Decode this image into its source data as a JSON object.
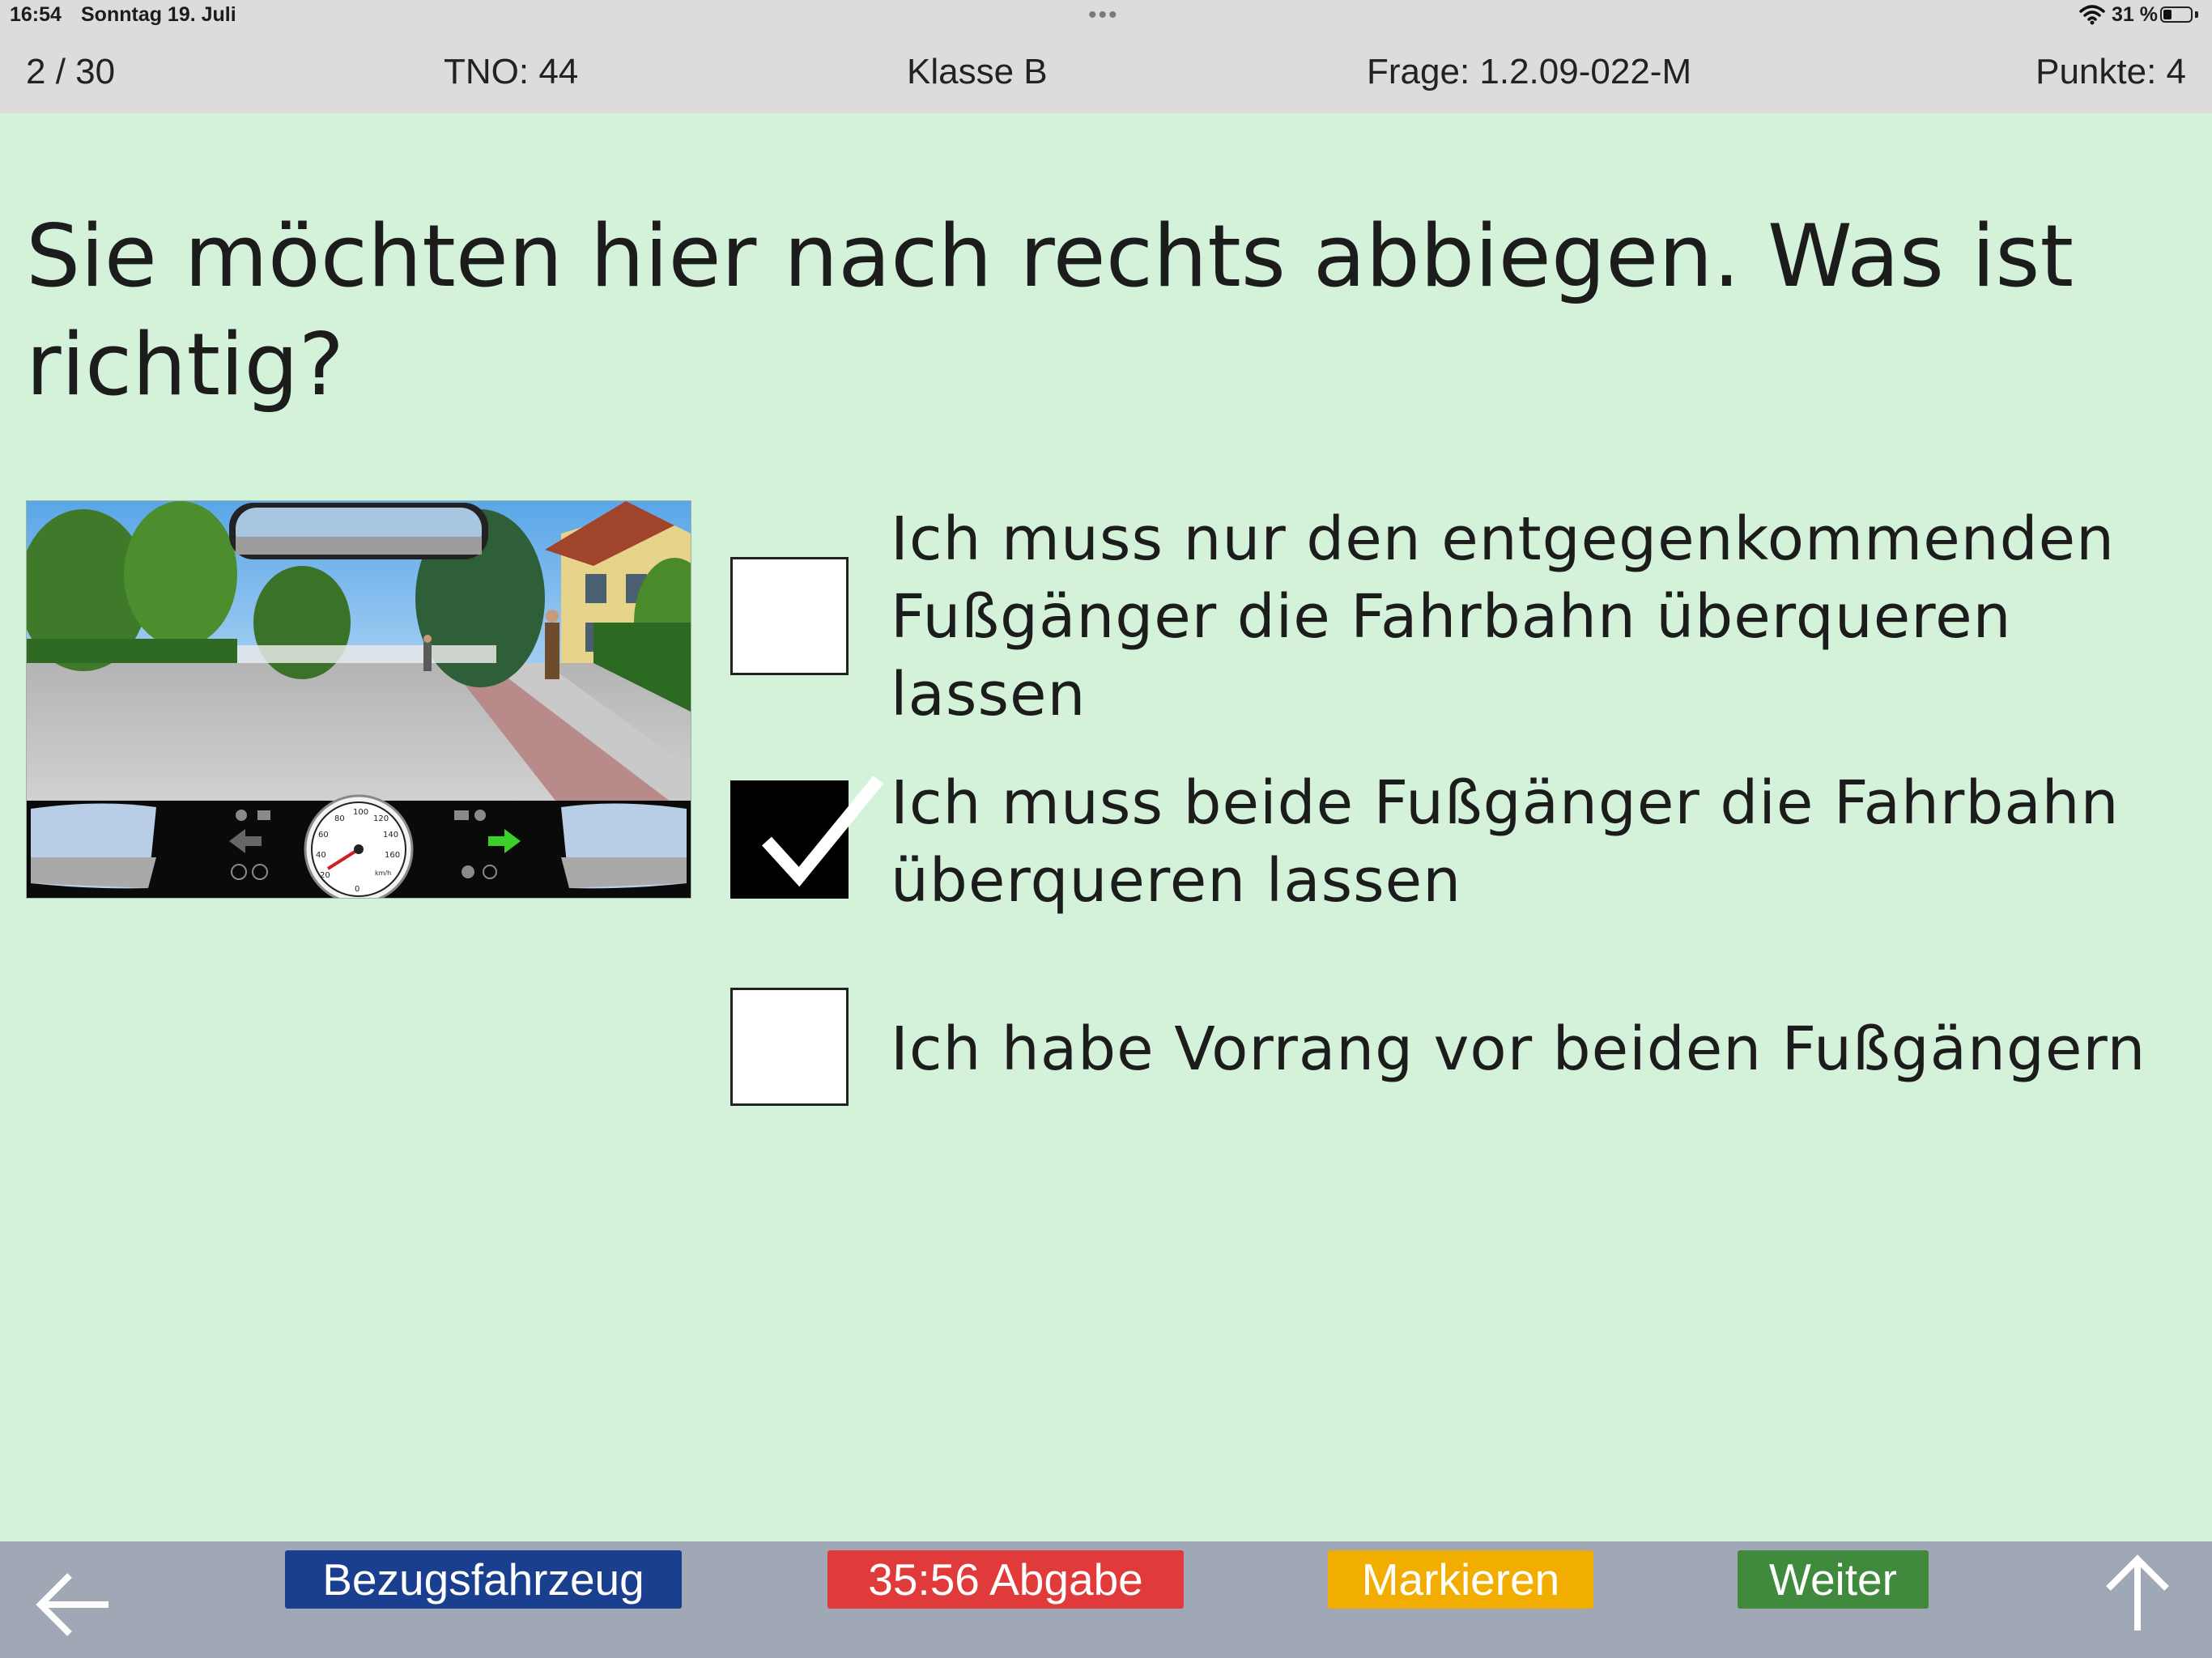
{
  "status_bar": {
    "time": "16:54",
    "date": "Sonntag 19. Juli",
    "battery": "31 %",
    "battery_level": 0.31,
    "icons": [
      "more-dots-icon",
      "wifi-icon",
      "battery-icon"
    ]
  },
  "header": {
    "progress": "2 / 30",
    "tno": "TNO: 44",
    "klasse": "Klasse B",
    "frage": "Frage: 1.2.09-022-M",
    "punkte": "Punkte: 4"
  },
  "question": {
    "text": "Sie möchten hier nach rechts abbiegen. Was ist richtig?"
  },
  "answers": [
    {
      "text": "Ich muss nur den entgegenkommenden Fußgänger die Fahrbahn überqueren lassen",
      "checked": false
    },
    {
      "text": "Ich muss beide Fußgänger die Fahrbahn überqueren lassen",
      "checked": true
    },
    {
      "text": "Ich habe Vorrang vor beiden Fußgängern",
      "checked": false
    }
  ],
  "footer": {
    "bezugsfahrzeug": "Bezugsfahrzeug",
    "abgabe": "35:56 Abgabe",
    "markieren": "Markieren",
    "weiter": "Weiter",
    "back_icon": "arrow-left-icon",
    "up_icon": "arrow-up-icon"
  },
  "colors": {
    "background": "#d4f2da",
    "bezugsfahrzeug": "#1a3f8f",
    "abgabe": "#e03a3a",
    "markieren": "#f2ae00",
    "weiter": "#3f8a3c",
    "footer_bar": "#a0a8b6"
  },
  "image": {
    "speedometer_ticks": [
      "20",
      "40",
      "60",
      "80",
      "100",
      "120",
      "140",
      "160",
      "0"
    ],
    "speedometer_unit": "km/h",
    "dash_icons": [
      "pedestrian-warning-icon",
      "low-beam-icon",
      "arrow-left-indicator-icon",
      "abs-icon",
      "brake-icon",
      "high-beam-icon",
      "traction-control-icon",
      "arrow-right-indicator-icon",
      "fog-light-icon",
      "stability-icon"
    ]
  }
}
